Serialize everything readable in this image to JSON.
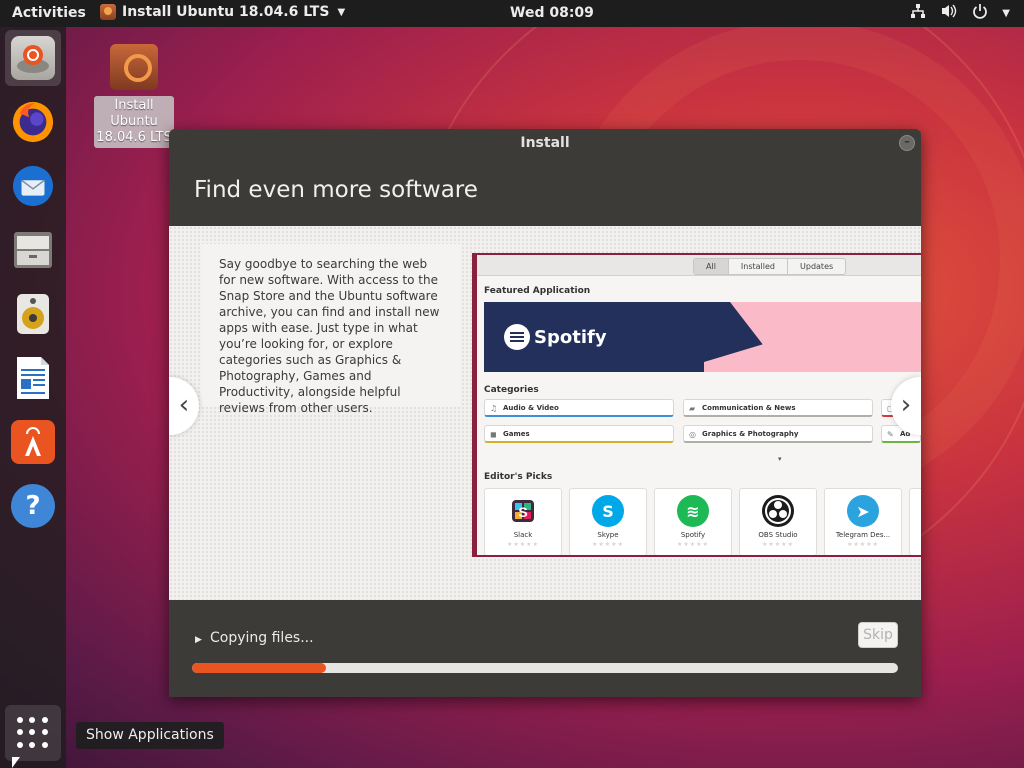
{
  "topbar": {
    "activities": "Activities",
    "app_menu": "Install Ubuntu 18.04.6 LTS",
    "clock": "Wed 08:09",
    "icons": [
      "network-icon",
      "volume-icon",
      "power-icon",
      "chevron-down-icon"
    ]
  },
  "dock": {
    "items": [
      {
        "name": "install-ubuntu",
        "icon": "installer-icon",
        "active": true
      },
      {
        "name": "firefox",
        "icon": "firefox-icon"
      },
      {
        "name": "thunderbird",
        "icon": "thunderbird-icon"
      },
      {
        "name": "files",
        "icon": "files-icon"
      },
      {
        "name": "rhythmbox",
        "icon": "rhythmbox-icon"
      },
      {
        "name": "libreoffice-writer",
        "icon": "writer-icon"
      },
      {
        "name": "ubuntu-software",
        "icon": "software-icon"
      },
      {
        "name": "help",
        "icon": "help-icon"
      }
    ],
    "tooltip": "Show Applications"
  },
  "desktop": {
    "icon_label": "Install Ubuntu 18.04.6 LTS"
  },
  "window": {
    "title": "Install",
    "heading": "Find even more software",
    "slide_text": "Say goodbye to searching the web for new software. With access to the Snap Store and the Ubuntu software archive, you can find and install new apps with ease. Just type in what you’re looking for, or explore categories such as Graphics & Photography, Games and Productivity, alongside helpful reviews from other users.",
    "store": {
      "tabs": [
        "All",
        "Installed",
        "Updates"
      ],
      "featured_label": "Featured Application",
      "featured_app": "Spotify",
      "categories_label": "Categories",
      "categories": [
        "Audio & Video",
        "Communication & News",
        "Games",
        "Graphics & Photography",
        "Ad"
      ],
      "editors_picks_label": "Editor's Picks",
      "picks": [
        "Slack",
        "Skype",
        "Spotify",
        "OBS Studio",
        "Telegram Des..."
      ]
    },
    "status": "Copying files...",
    "skip_label": "Skip",
    "progress": 0.19
  },
  "colors": {
    "accent": "#e95420",
    "window_bg": "#3c3b37",
    "store_border": "#8a2040"
  }
}
